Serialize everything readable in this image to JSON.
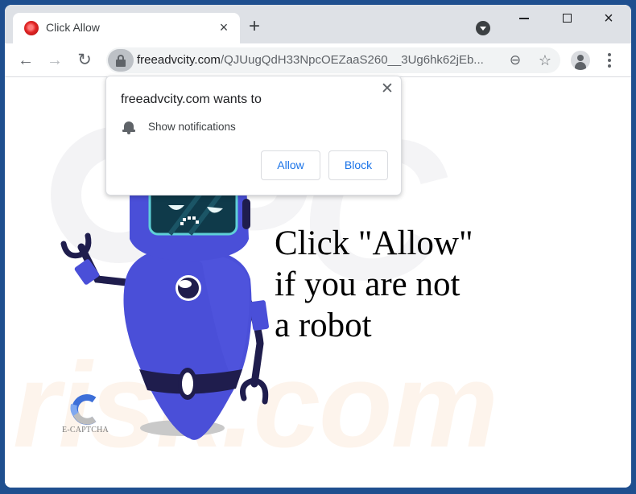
{
  "browser": {
    "tab": {
      "title": "Click Allow",
      "favicon": "red-circle-favicon",
      "close_icon": "×"
    },
    "new_tab_icon": "+",
    "window_controls": {
      "minimize": "minimize",
      "maximize": "maximize",
      "close": "×"
    },
    "nav": {
      "back_icon": "←",
      "forward_icon": "→",
      "reload_icon": "↻"
    },
    "address_bar": {
      "domain": "freeadvcity.com",
      "path": "/QJUugQdH33NpcOEZaaS260__3Ug6hk62jEb..."
    },
    "omnibox_icons": {
      "zoom": "⊖",
      "bookmark": "☆"
    }
  },
  "permission_popup": {
    "title": "freeadvcity.com wants to",
    "permission": "Show notifications",
    "close_icon": "✕",
    "allow_label": "Allow",
    "block_label": "Block",
    "button_color": "#1a73e8"
  },
  "page": {
    "headline": [
      "Click \"Allow\"",
      "if you are not",
      "a robot"
    ],
    "captcha_label": "E-CAPTCHA",
    "watermark": {
      "top": "PC",
      "bottom": "risk.com"
    },
    "colors": {
      "robot_body": "#4a4fd8",
      "robot_dark": "#1f1d4d",
      "visor": "#0f3a4a",
      "visor_rim": "#5fd0d8"
    }
  }
}
